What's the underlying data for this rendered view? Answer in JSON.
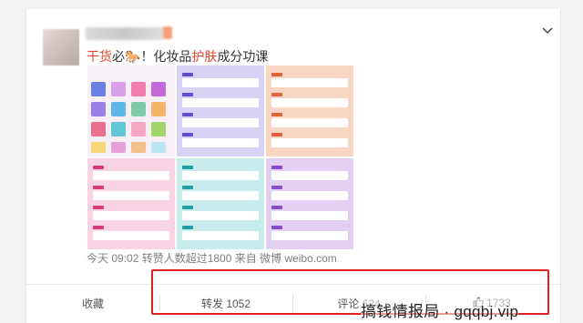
{
  "post": {
    "text_part1": "干货",
    "text_part2": "必",
    "text_emoji": "🐎",
    "text_part3": "！化妆品",
    "text_part4": "护肤",
    "text_part5": "成分功课",
    "meta": "今天 09:02 转赞人数超过1800  来自 微博 weibo.com"
  },
  "actions": {
    "favorite": "收藏",
    "repost": "转发 1052",
    "comment": "评论 624",
    "like": "1733"
  },
  "watermark": "搞钱情报局 · gqqbj.vip",
  "icons": [
    "chevron-down-icon",
    "thumbs-up-icon"
  ],
  "colors": {
    "highlight": "#e8452c",
    "annotation_box": "#e02020"
  }
}
